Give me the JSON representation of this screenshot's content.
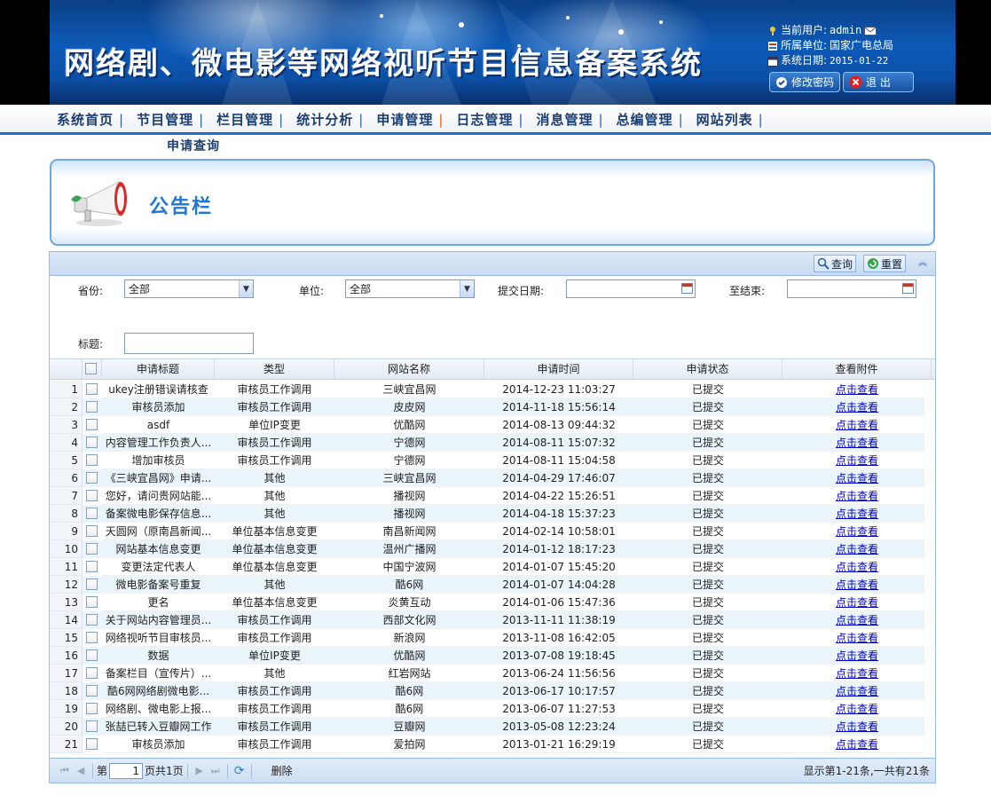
{
  "header": {
    "title": "网络剧、微电影等网络视听节目信息备案系统",
    "current_user_label": "当前用户:",
    "current_user": "admin",
    "unit_label": "所属单位:",
    "unit": "国家广电总局",
    "date_label": "系统日期:",
    "date": "2015-01-22",
    "change_password": "修改密码",
    "logout": "退 出"
  },
  "nav": {
    "items": [
      {
        "label": "系统首页"
      },
      {
        "label": "节目管理"
      },
      {
        "label": "栏目管理"
      },
      {
        "label": "统计分析"
      },
      {
        "label": "申请管理"
      },
      {
        "label": "日志管理"
      },
      {
        "label": "消息管理"
      },
      {
        "label": "总编管理"
      },
      {
        "label": "网站列表"
      }
    ],
    "active_index": 4,
    "sub_item": "申请查询"
  },
  "board": {
    "title": "公告栏"
  },
  "toolbar": {
    "query": "查询",
    "reset": "重置"
  },
  "filters": {
    "province_label": "省份:",
    "province_value": "全部",
    "unit_label": "单位:",
    "unit_value": "全部",
    "submit_date_label": "提交日期:",
    "submit_date_value": "",
    "end_label": "至结束:",
    "end_value": "",
    "title_label": "标题:",
    "title_value": ""
  },
  "table": {
    "columns": [
      "申请标题",
      "类型",
      "网站名称",
      "申请时间",
      "申请状态",
      "查看附件"
    ],
    "link_text": "点击查看",
    "rows": [
      {
        "n": "1",
        "title": "ukey注册错误请核查",
        "type": "审核员工作调用",
        "site": "三峡宜昌网",
        "time": "2014-12-23 11:03:27",
        "status": "已提交"
      },
      {
        "n": "2",
        "title": "审核员添加",
        "type": "审核员工作调用",
        "site": "皮皮网",
        "time": "2014-11-18 15:56:14",
        "status": "已提交"
      },
      {
        "n": "3",
        "title": "asdf",
        "type": "单位IP变更",
        "site": "优酷网",
        "time": "2014-08-13 09:44:32",
        "status": "已提交"
      },
      {
        "n": "4",
        "title": "内容管理工作负责人...",
        "type": "审核员工作调用",
        "site": "宁德网",
        "time": "2014-08-11 15:07:32",
        "status": "已提交"
      },
      {
        "n": "5",
        "title": "增加审核员",
        "type": "审核员工作调用",
        "site": "宁德网",
        "time": "2014-08-11 15:04:58",
        "status": "已提交"
      },
      {
        "n": "6",
        "title": "《三峡宜昌网》申请...",
        "type": "其他",
        "site": "三峡宜昌网",
        "time": "2014-04-29 17:46:07",
        "status": "已提交"
      },
      {
        "n": "7",
        "title": "您好，请问贵网站能...",
        "type": "其他",
        "site": "播视网",
        "time": "2014-04-22 15:26:51",
        "status": "已提交"
      },
      {
        "n": "8",
        "title": "备案微电影保存信息...",
        "type": "其他",
        "site": "播视网",
        "time": "2014-04-18 15:37:23",
        "status": "已提交"
      },
      {
        "n": "9",
        "title": "天圆网（原南昌新闻...",
        "type": "单位基本信息变更",
        "site": "南昌新闻网",
        "time": "2014-02-14 10:58:01",
        "status": "已提交"
      },
      {
        "n": "10",
        "title": "网站基本信息变更",
        "type": "单位基本信息变更",
        "site": "温州广播网",
        "time": "2014-01-12 18:17:23",
        "status": "已提交"
      },
      {
        "n": "11",
        "title": "变更法定代表人",
        "type": "单位基本信息变更",
        "site": "中国宁波网",
        "time": "2014-01-07 15:45:20",
        "status": "已提交"
      },
      {
        "n": "12",
        "title": "微电影备案号重复",
        "type": "其他",
        "site": "酷6网",
        "time": "2014-01-07 14:04:28",
        "status": "已提交"
      },
      {
        "n": "13",
        "title": "更名",
        "type": "单位基本信息变更",
        "site": "炎黄互动",
        "time": "2014-01-06 15:47:36",
        "status": "已提交"
      },
      {
        "n": "14",
        "title": "关于网站内容管理员...",
        "type": "审核员工作调用",
        "site": "西部文化网",
        "time": "2013-11-11 11:38:19",
        "status": "已提交"
      },
      {
        "n": "15",
        "title": "网络视听节目审核员...",
        "type": "审核员工作调用",
        "site": "新浪网",
        "time": "2013-11-08 16:42:05",
        "status": "已提交"
      },
      {
        "n": "16",
        "title": "数据",
        "type": "单位IP变更",
        "site": "优酷网",
        "time": "2013-07-08 19:18:45",
        "status": "已提交"
      },
      {
        "n": "17",
        "title": "备案栏目（宣传片）...",
        "type": "其他",
        "site": "红岩网站",
        "time": "2013-06-24 11:56:56",
        "status": "已提交"
      },
      {
        "n": "18",
        "title": "酷6网网络剧微电影...",
        "type": "审核员工作调用",
        "site": "酷6网",
        "time": "2013-06-17 10:17:57",
        "status": "已提交"
      },
      {
        "n": "19",
        "title": "网络剧、微电影上报...",
        "type": "审核员工作调用",
        "site": "酷6网",
        "time": "2013-06-07 11:27:53",
        "status": "已提交"
      },
      {
        "n": "20",
        "title": "张喆已转入豆瓣网工作",
        "type": "审核员工作调用",
        "site": "豆瓣网",
        "time": "2013-05-08 12:23:24",
        "status": "已提交"
      },
      {
        "n": "21",
        "title": "审核员添加",
        "type": "审核员工作调用",
        "site": "爱拍网",
        "time": "2013-01-21 16:29:19",
        "status": "已提交"
      }
    ]
  },
  "pager": {
    "page_prefix": "第",
    "page_value": "1",
    "page_suffix": "页共1页",
    "delete": "删除",
    "summary": "显示第1-21条,一共有21条"
  },
  "colors": {
    "nav_accent": "#1a6fd0",
    "link": "#0000cc",
    "row_alt": "#eaf4fb",
    "board_title": "#1e76d6"
  }
}
